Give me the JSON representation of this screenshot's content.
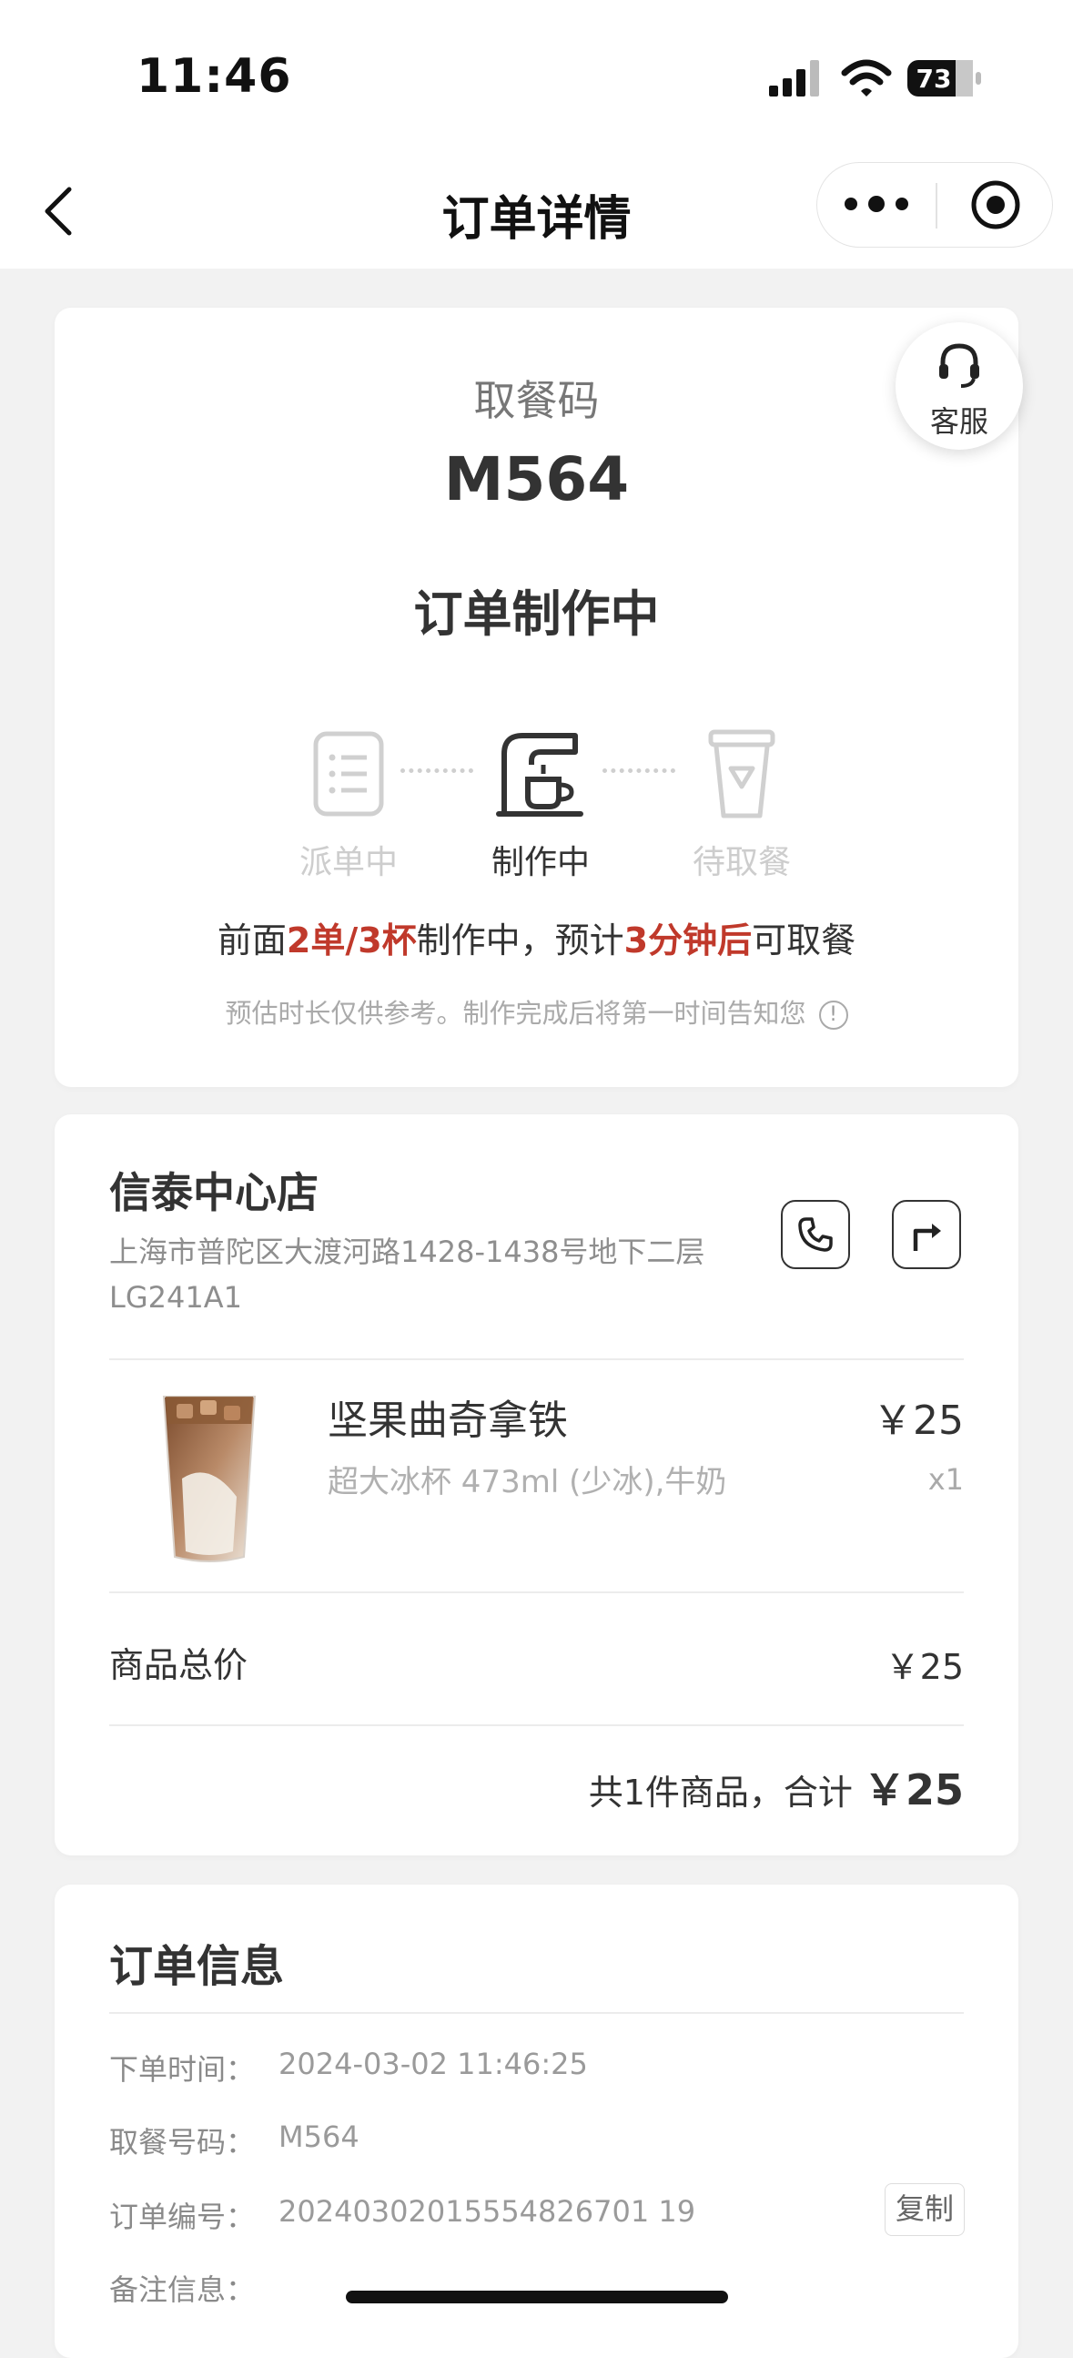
{
  "status_bar": {
    "time": "11:46",
    "battery": "73"
  },
  "nav": {
    "title": "订单详情"
  },
  "pickup": {
    "label": "取餐码",
    "code": "M564",
    "status": "订单制作中",
    "customer_service": "客服",
    "steps": [
      {
        "label": "派单中",
        "state": "inactive",
        "icon": "receipt-icon"
      },
      {
        "label": "制作中",
        "state": "active",
        "icon": "coffee-machine-icon"
      },
      {
        "label": "待取餐",
        "state": "inactive",
        "icon": "cup-icon"
      }
    ],
    "queue": {
      "prefix": "前面",
      "orders_cups": "2单/3杯",
      "middle": "制作中，预计",
      "wait": "3分钟后",
      "suffix": "可取餐"
    },
    "note": "预估时长仅供参考。制作完成后将第一时间告知您"
  },
  "store": {
    "name": "信泰中心店",
    "address": "上海市普陀区大渡河路1428-1438号地下二层LG241A1"
  },
  "product": {
    "name": "坚果曲奇拿铁",
    "spec": "超大冰杯 473ml (少冰),牛奶",
    "price": "￥25",
    "qty": "x1"
  },
  "summary": {
    "subtotal_label": "商品总价",
    "subtotal_value": "￥25",
    "total_prefix": "共1件商品，合计 ",
    "total_value": "￥25"
  },
  "order_info": {
    "title": "订单信息",
    "rows": [
      {
        "label": "下单时间：",
        "value": "2024-03-02 11:46:25"
      },
      {
        "label": "取餐号码：",
        "value": "M564"
      },
      {
        "label": "订单编号：",
        "value": "20240302015554826701 19"
      },
      {
        "label": "备注信息：",
        "value": ""
      }
    ],
    "copy_label": "复制"
  },
  "colors": {
    "accent_red": "#c0392b",
    "background": "#f2f2f2"
  }
}
